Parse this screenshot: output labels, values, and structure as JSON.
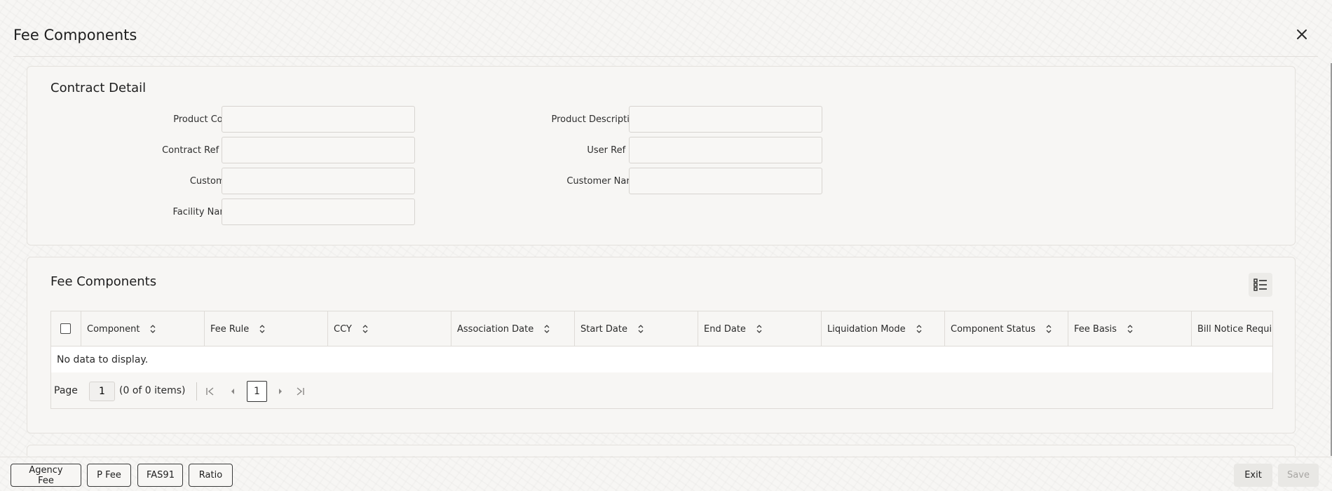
{
  "window": {
    "title": "Fee Components"
  },
  "contract_detail": {
    "title": "Contract Detail",
    "fields": {
      "product_code": {
        "label": "Product Code",
        "value": ""
      },
      "product_description": {
        "label": "Product Description",
        "value": ""
      },
      "contract_ref_no": {
        "label": "Contract Ref No",
        "value": ""
      },
      "user_ref_no": {
        "label": "User Ref No",
        "value": ""
      },
      "customer": {
        "label": "Customer",
        "value": ""
      },
      "customer_name": {
        "label": "Customer Name",
        "value": ""
      },
      "facility_name": {
        "label": "Facility Name",
        "value": ""
      }
    }
  },
  "fee_components": {
    "title": "Fee Components",
    "columns": [
      "Component",
      "Fee Rule",
      "CCY",
      "Association Date",
      "Start Date",
      "End Date",
      "Liquidation Mode",
      "Component Status",
      "Fee Basis",
      "Bill Notice Required"
    ],
    "empty_message": "No data to display.",
    "pager": {
      "label": "Page",
      "page_input": "1",
      "info": "(0 of 0 items)",
      "current_page": "1"
    }
  },
  "footer": {
    "buttons": {
      "agency_fee": "Agency Fee",
      "p_fee": "P Fee",
      "fas91": "FAS91",
      "ratio": "Ratio",
      "exit": "Exit",
      "save": "Save"
    }
  },
  "icons": {
    "close": "close-icon",
    "column_picker": "column-list-icon",
    "sort": "sort-icon",
    "first_page": "first-page-icon",
    "prev_page": "prev-page-icon",
    "next_page": "next-page-icon",
    "last_page": "last-page-icon"
  }
}
